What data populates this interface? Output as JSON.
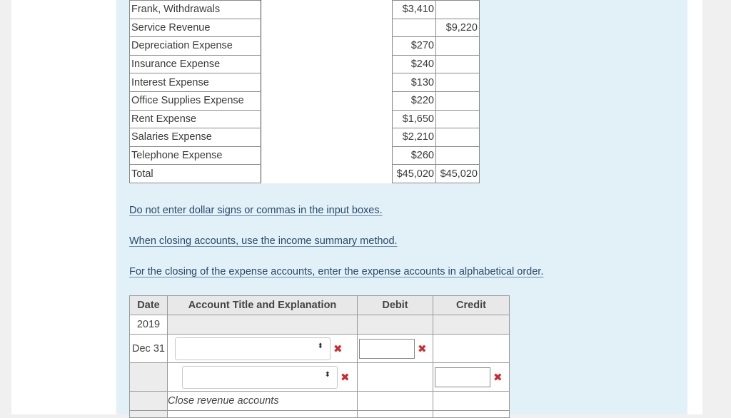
{
  "trial_balance": {
    "rows": [
      {
        "account": "Frank, Withdrawals",
        "debit": "$3,410",
        "credit": ""
      },
      {
        "account": "Service Revenue",
        "debit": "",
        "credit": "$9,220"
      },
      {
        "account": "Depreciation Expense",
        "debit": "$270",
        "credit": ""
      },
      {
        "account": "Insurance Expense",
        "debit": "$240",
        "credit": ""
      },
      {
        "account": "Interest Expense",
        "debit": "$130",
        "credit": ""
      },
      {
        "account": "Office Supplies Expense",
        "debit": "$220",
        "credit": ""
      },
      {
        "account": "Rent Expense",
        "debit": "$1,650",
        "credit": ""
      },
      {
        "account": "Salaries Expense",
        "debit": "$2,210",
        "credit": ""
      },
      {
        "account": "Telephone Expense",
        "debit": "$260",
        "credit": ""
      },
      {
        "account": "Total",
        "debit": "$45,020",
        "credit": "$45,020"
      }
    ]
  },
  "instructions": {
    "note1": "Do not enter dollar signs or commas in the input boxes.",
    "note2": "When closing accounts, use the income summary method.",
    "note3": "For the closing of the expense accounts, enter the expense accounts in alphabetical order."
  },
  "journal": {
    "headers": {
      "date": "Date",
      "account": "Account Title and Explanation",
      "debit": "Debit",
      "credit": "Credit"
    },
    "year": "2019",
    "entry_date": "Dec 31",
    "memo": "Close revenue accounts",
    "select_arrows": "⬍",
    "error_mark": "✖",
    "error_color": "#d0282d"
  }
}
